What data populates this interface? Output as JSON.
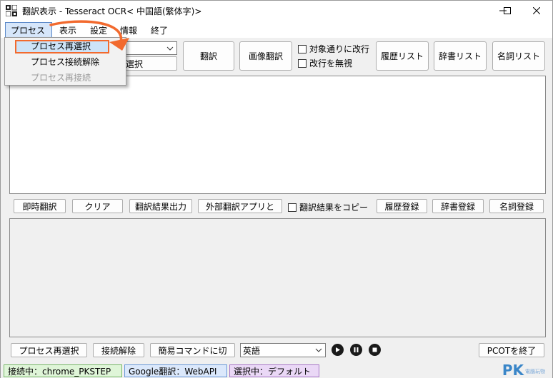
{
  "window": {
    "title": "翻訳表示 - Tesseract OCR< 中国語(繁体字)>",
    "minimize_label": "─",
    "maximize_label": "□",
    "close_label": "✕"
  },
  "menubar": {
    "items": [
      {
        "label": "プロセス"
      },
      {
        "label": "表示"
      },
      {
        "label": "設定"
      },
      {
        "label": "情報"
      },
      {
        "label": "終了"
      }
    ]
  },
  "process_menu": {
    "items": [
      {
        "label": "プロセス再選択",
        "enabled": true,
        "highlighted": true
      },
      {
        "label": "プロセス接続解除",
        "enabled": true
      },
      {
        "label": "プロセス再接続",
        "enabled": false
      }
    ]
  },
  "toolbar": {
    "select_partial": "選択",
    "translate_label": "翻訳",
    "image_translate_label": "画像翻訳",
    "line_break_check": "対象通りに改行",
    "ignore_break_check": "改行を無視",
    "history_list_label": "履歴リスト",
    "dictionary_list_label": "辞書リスト",
    "noun_list_label": "名詞リスト"
  },
  "middle_bar": {
    "instant_translate_label": "即時翻訳",
    "clear_label": "クリア",
    "output_label": "翻訳結果出力",
    "external_app_label": "外部翻訳アプリと",
    "copy_result_check": "翻訳結果をコピー",
    "history_register_label": "履歴登録",
    "dictionary_register_label": "辞書登録",
    "noun_register_label": "名詞登録"
  },
  "bottom_bar": {
    "reselect_label": "プロセス再選択",
    "disconnect_label": "接続解除",
    "simple_command_label": "簡易コマンドに切",
    "language_value": "英語",
    "quit_label": "PCOTを終了"
  },
  "statusbar": {
    "connected": "接続中：chrome_PKSTEP",
    "engine": "Google翻訳：WebAPI",
    "selected": "選択中：デフォルト"
  },
  "watermark": {
    "logo": "PK",
    "sub": "電腦玩物"
  },
  "colors": {
    "accent_orange": "#f26a2e",
    "status_green_bg": "#dff5d8",
    "status_blue_bg": "#dbe8fb",
    "status_purple_bg": "#ead8f6"
  }
}
